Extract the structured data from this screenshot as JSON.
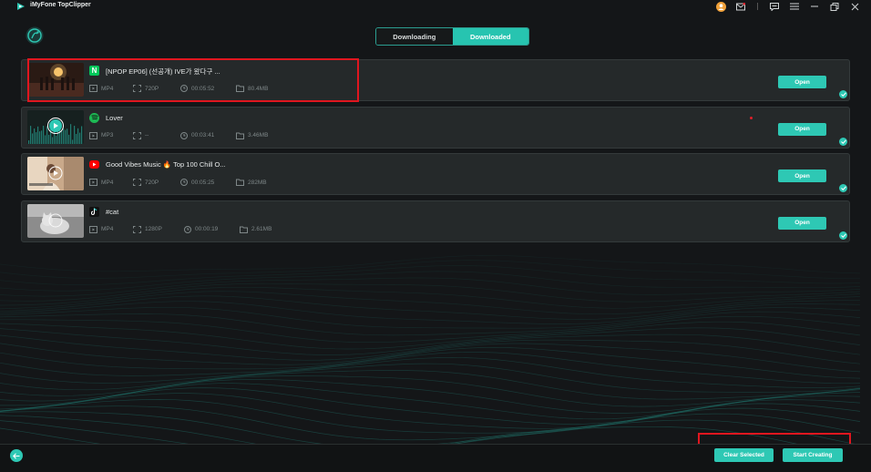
{
  "app": {
    "title": "iMyFone TopClipper"
  },
  "tabs": [
    {
      "label": "Downloading",
      "active": false
    },
    {
      "label": "Downloaded",
      "active": true
    }
  ],
  "items": [
    {
      "source": "naver",
      "source_glyph": "N",
      "title": "[NPOP EP06] (선공개) IVE가 왔다구 ...",
      "format": "MP4",
      "resolution": "720P",
      "duration": "00:05:52",
      "size": "80.4MB",
      "action": "Open"
    },
    {
      "source": "spotify",
      "title": "Lover",
      "format": "MP3",
      "resolution": "--",
      "duration": "00:03:41",
      "size": "3.46MB",
      "action": "Open"
    },
    {
      "source": "youtube",
      "title": "Good Vibes Music 🔥 Top 100 Chill O...",
      "format": "MP4",
      "resolution": "720P",
      "duration": "00:05:25",
      "size": "282MB",
      "action": "Open"
    },
    {
      "source": "tiktok",
      "title": "#cat",
      "format": "MP4",
      "resolution": "1280P",
      "duration": "00:00:19",
      "size": "2.61MB",
      "action": "Open"
    }
  ],
  "footer": {
    "clear_label": "Clear Selected",
    "create_label": "Start Creating"
  },
  "colors": {
    "accent": "#2ec8b4",
    "background": "#141618",
    "row": "#25292a",
    "highlight": "#e0161f"
  },
  "icons": [
    "app-logo-icon",
    "user-avatar-icon",
    "mail-icon",
    "feedback-icon",
    "menu-icon",
    "minimize-icon",
    "restore-icon",
    "close-icon",
    "back-arrow-icon"
  ]
}
